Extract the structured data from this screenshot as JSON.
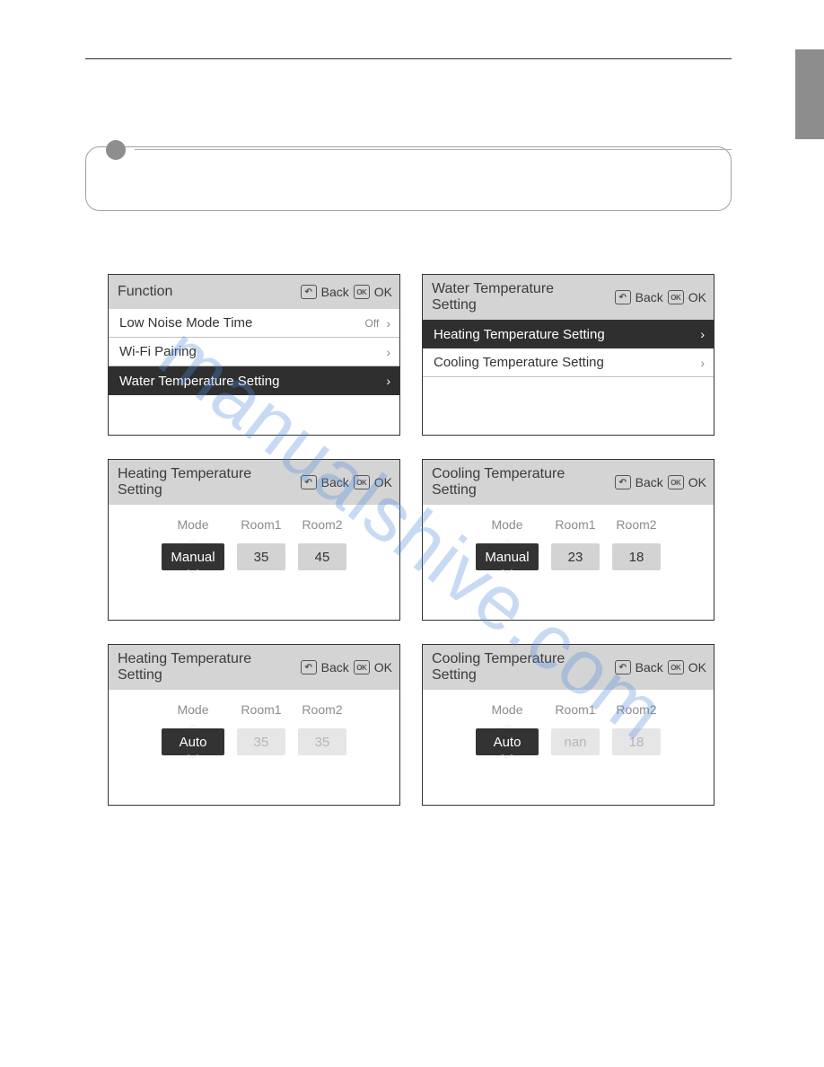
{
  "watermark": "manualshive.com",
  "nav": {
    "back": "Back",
    "ok": "OK",
    "ok_icon": "OK",
    "back_icon": "↶"
  },
  "panels": [
    {
      "title": "Function",
      "tall": false,
      "type": "menu",
      "rows": [
        {
          "label": "Low Noise Mode Time",
          "suffix": "Off",
          "dark": false
        },
        {
          "label": "Wi-Fi Pairing",
          "suffix": "",
          "dark": false
        },
        {
          "label": "Water Temperature Setting",
          "suffix": "",
          "dark": true
        }
      ]
    },
    {
      "title": "Water Temperature Setting",
      "tall": true,
      "type": "menu",
      "rows": [
        {
          "label": "Heating Temperature Setting",
          "suffix": "",
          "dark": true
        },
        {
          "label": "Cooling Temperature Setting",
          "suffix": "",
          "dark": false
        }
      ]
    },
    {
      "title": "Heating Temperature Setting",
      "tall": true,
      "type": "selector",
      "cols": [
        {
          "label": "Mode",
          "value": "Manual",
          "kind": "mode",
          "arrows": true
        },
        {
          "label": "Room1",
          "value": "35",
          "kind": "num",
          "arrows": false
        },
        {
          "label": "Room2",
          "value": "45",
          "kind": "num",
          "arrows": false
        }
      ]
    },
    {
      "title": "Cooling Temperature Setting",
      "tall": true,
      "type": "selector",
      "cols": [
        {
          "label": "Mode",
          "value": "Manual",
          "kind": "mode",
          "arrows": true
        },
        {
          "label": "Room1",
          "value": "23",
          "kind": "num",
          "arrows": false
        },
        {
          "label": "Room2",
          "value": "18",
          "kind": "num",
          "arrows": false
        }
      ]
    },
    {
      "title": "Heating Temperature Setting",
      "tall": true,
      "type": "selector",
      "cols": [
        {
          "label": "Mode",
          "value": "Auto",
          "kind": "mode",
          "arrows": true
        },
        {
          "label": "Room1",
          "value": "35",
          "kind": "dim",
          "arrows": false
        },
        {
          "label": "Room2",
          "value": "35",
          "kind": "dim",
          "arrows": false
        }
      ]
    },
    {
      "title": "Cooling Temperature Setting",
      "tall": true,
      "type": "selector",
      "cols": [
        {
          "label": "Mode",
          "value": "Auto",
          "kind": "mode",
          "arrows": true
        },
        {
          "label": "Room1",
          "value": "nan",
          "kind": "dim",
          "arrows": false
        },
        {
          "label": "Room2",
          "value": "18",
          "kind": "dim",
          "arrows": false
        }
      ]
    }
  ]
}
